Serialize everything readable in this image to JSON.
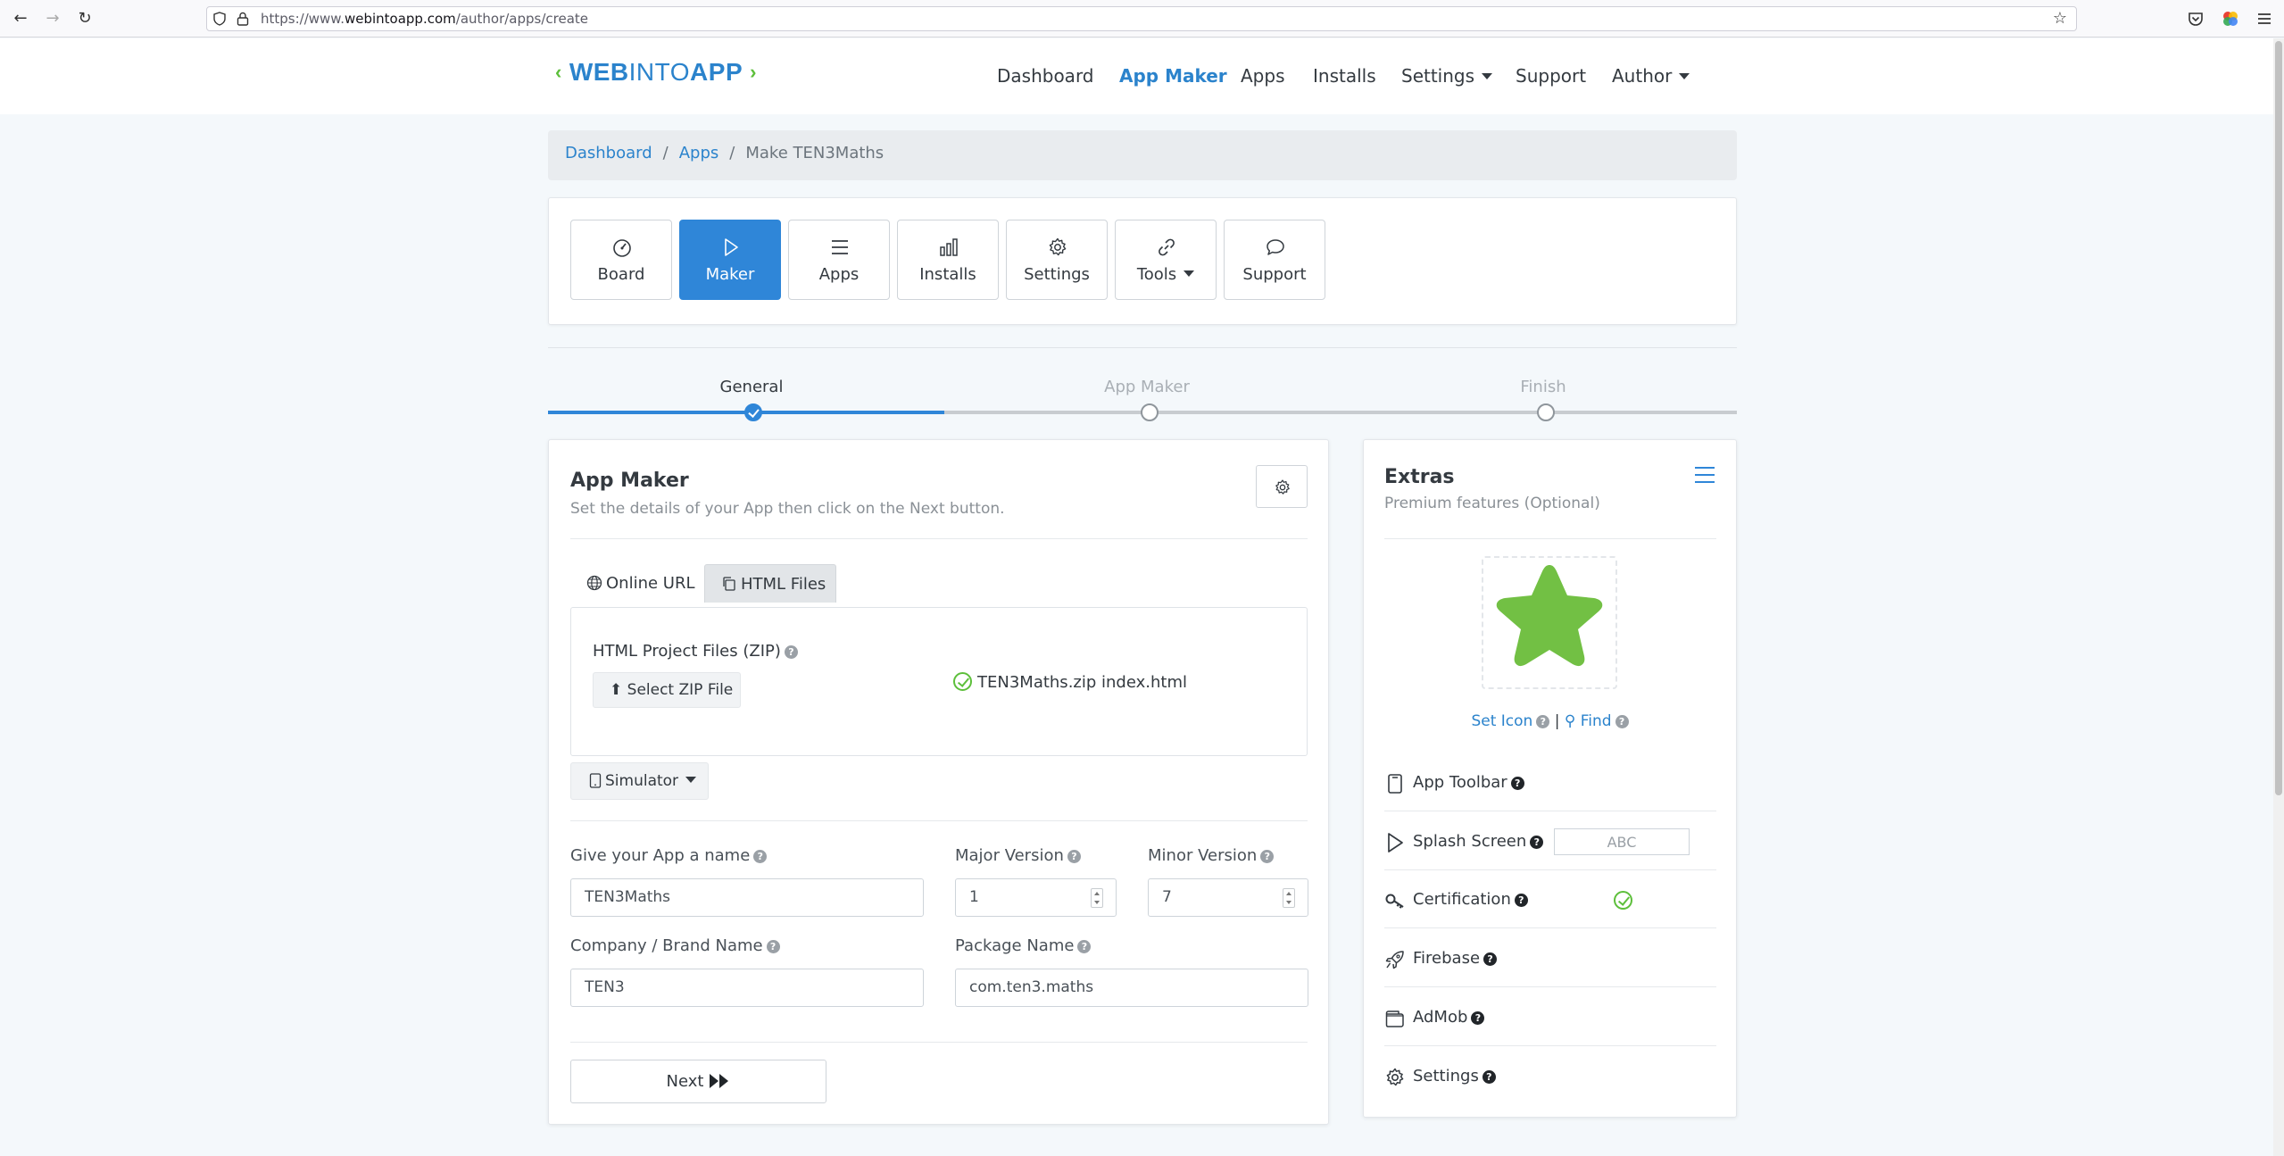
{
  "browser": {
    "url_prefix": "https://www.",
    "url_domain": "webintoapp.com",
    "url_path": "/author/apps/create"
  },
  "logo": {
    "part1": "WEB",
    "part2": "INTO",
    "part3": "APP"
  },
  "topnav": {
    "dashboard": "Dashboard",
    "app_maker": "App Maker",
    "apps": "Apps",
    "installs": "Installs",
    "settings": "Settings",
    "support": "Support",
    "author": "Author"
  },
  "breadcrumb": {
    "item1": "Dashboard",
    "item2": "Apps",
    "current": "Make TEN3Maths"
  },
  "toolbar": {
    "board": "Board",
    "maker": "Maker",
    "apps": "Apps",
    "installs": "Installs",
    "settings": "Settings",
    "tools": "Tools",
    "support": "Support"
  },
  "stepper": {
    "step1": "General",
    "step2": "App Maker",
    "step3": "Finish",
    "active_step": 1
  },
  "app_maker": {
    "title": "App Maker",
    "subtitle": "Set the details of your App then click on the Next button.",
    "tab_online": "Online URL",
    "tab_html": "HTML Files",
    "zip_label": "HTML Project Files (ZIP)",
    "zip_button": "Select ZIP File",
    "zip_status": "TEN3Maths.zip index.html",
    "simulator": "Simulator",
    "name_label": "Give your App a name",
    "name_value": "TEN3Maths",
    "major_label": "Major Version",
    "major_value": "1",
    "minor_label": "Minor Version",
    "minor_value": "7",
    "company_label": "Company / Brand Name",
    "company_value": "TEN3",
    "package_label": "Package Name",
    "package_value": "com.ten3.maths",
    "next": "Next"
  },
  "extras": {
    "title": "Extras",
    "subtitle": "Premium features (Optional)",
    "set_icon": "Set Icon",
    "sep": "|",
    "find": "Find",
    "app_toolbar": "App Toolbar",
    "splash_screen": "Splash Screen",
    "splash_placeholder": "ABC",
    "certification": "Certification",
    "firebase": "Firebase",
    "admob": "AdMob",
    "settings": "Settings"
  },
  "colors": {
    "accent": "#2f86d8",
    "link": "#2b83cc",
    "green": "#5dbf3b"
  }
}
